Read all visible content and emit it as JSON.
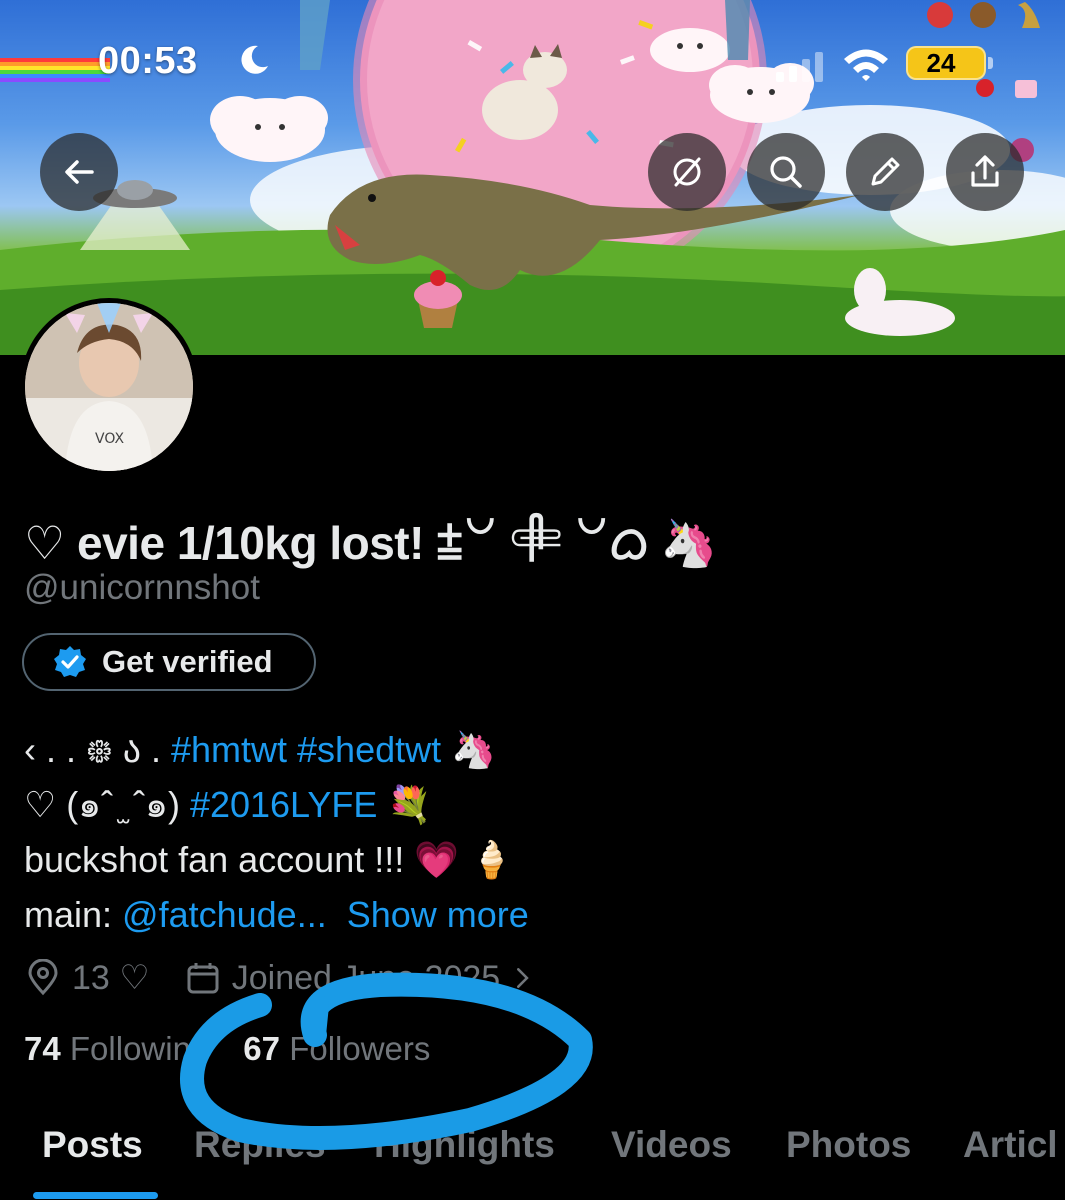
{
  "status_bar": {
    "time": "00:53",
    "battery": "24"
  },
  "banner": {
    "description_icons": [
      "unicorn-dinosaur-collage"
    ]
  },
  "header_buttons": {
    "back": "back-arrow-icon",
    "grok": "grok-icon",
    "search": "search-icon",
    "edit": "pencil-icon",
    "share": "share-icon"
  },
  "profile": {
    "display_name": "♡ evie 1/10kg lost! ⩲꒡ 𓄸 ꒡ᜊ 🦄",
    "handle": "@unicornnshot",
    "verify_button_label": "Get verified",
    "bio": {
      "line1_prefix": "‹ . . ᪥ ა . ",
      "line1_tags": "#hmtwt #shedtwt",
      "line1_suffix": " 🦄",
      "line2_prefix": "♡ (๑ˆ ̫ ˆ๑) ",
      "line2_tag": "#2016LYFE",
      "line2_suffix": " 💐",
      "line3": "buckshot fan account !!! 💗 🍦",
      "line4_prefix": "main: ",
      "line4_link": "@fatchude...",
      "line4_more": "Show more"
    },
    "location": "13 ♡",
    "joined": "Joined June 2025",
    "following_count": "74",
    "following_label": "Following",
    "followers_count": "67",
    "followers_label": "Followers"
  },
  "tabs": [
    {
      "label": "Posts",
      "active": true
    },
    {
      "label": "Replies",
      "active": false
    },
    {
      "label": "Highlights",
      "active": false
    },
    {
      "label": "Videos",
      "active": false
    },
    {
      "label": "Photos",
      "active": false
    },
    {
      "label": "Articl",
      "active": false
    }
  ],
  "colors": {
    "accent": "#1d9bf0",
    "background": "#000000",
    "text_primary": "#e7e9ea",
    "text_secondary": "#71767b",
    "scribble": "#1a9be6"
  }
}
